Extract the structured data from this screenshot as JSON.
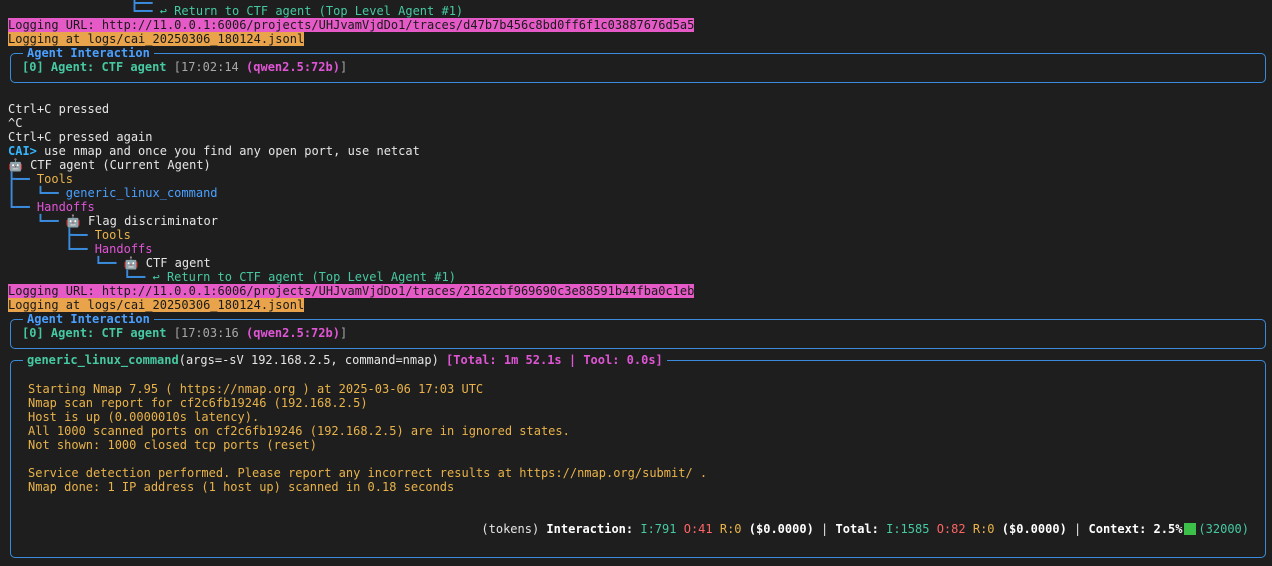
{
  "top": {
    "return_line": "↩ Return to CTF agent (Top Level Agent #1)",
    "log_url_1": "Logging URL: http://11.0.0.1:6006/projects/UHJvamVjdDo1/traces/d47b7b456c8bd0ff6f1c03887676d5a5",
    "log_file_1": "Logging at logs/cai_20250306_180124.jsonl"
  },
  "interaction1": {
    "title": "Agent Interaction",
    "index": "[0]",
    "agent": "Agent: CTF agent",
    "time": "[17:02:14",
    "model": "(qwen2.5:72b)",
    "close": "]"
  },
  "ctrl": {
    "l1": "Ctrl+C pressed",
    "l2": "^C",
    "l3": "Ctrl+C pressed again"
  },
  "prompt": {
    "label": "CAI>",
    "text": " use nmap and once you find any open port, use netcat"
  },
  "tree": {
    "root": "🤖 CTF agent (Current Agent)",
    "tools": "Tools",
    "tool1": "generic_linux_command",
    "handoffs": "Handoffs",
    "flag": "🤖 Flag discriminator",
    "tools2": "Tools",
    "handoffs2": "Handoffs",
    "ctf": "🤖 CTF agent",
    "return": "↩ Return to CTF agent (Top Level Agent #1)"
  },
  "log2": {
    "url": "Logging URL: http://11.0.0.1:6006/projects/UHJvamVjdDo1/traces/2162cbf969690c3e88591b44fba0c1eb",
    "file": "Logging at logs/cai_20250306_180124.jsonl"
  },
  "interaction2": {
    "title": "Agent Interaction",
    "index": "[0]",
    "agent": "Agent: CTF agent",
    "time": "[17:03:16",
    "model": "(qwen2.5:72b)",
    "close": "]"
  },
  "tool_box": {
    "name": "generic_linux_command",
    "args": "(args=-sV 192.168.2.5, command=nmap)",
    "total": "[Total: 1m 52.1s | Tool: 0.0s]",
    "output": [
      "Starting Nmap 7.95 ( https://nmap.org ) at 2025-03-06 17:03 UTC",
      "Nmap scan report for cf2c6fb19246 (192.168.2.5)",
      "Host is up (0.0000010s latency).",
      "All 1000 scanned ports on cf2c6fb19246 (192.168.2.5) are in ignored states.",
      "Not shown: 1000 closed tcp ports (reset)",
      "",
      "Service detection performed. Please report any incorrect results at https://nmap.org/submit/ .",
      "Nmap done: 1 IP address (1 host up) scanned in 0.18 seconds"
    ],
    "tokens": {
      "prefix": "(tokens)",
      "interaction_label": "Interaction:",
      "i1": "I:791",
      "o1": "O:41",
      "r1": "R:0",
      "cost1": "($0.0000)",
      "sep1": "|",
      "total_label": "Total:",
      "i2": "I:1585",
      "o2": "O:82",
      "r2": "R:0",
      "cost2": "($0.0000)",
      "sep2": "|",
      "context_label": "Context: 2.5%",
      "context_max": "(32000)"
    }
  },
  "colors": {
    "background": "#1e1e1e",
    "box_border": "#3a8bdc",
    "pink_highlight": "#e55ac7",
    "orange_highlight": "#e8a34b",
    "green": "#46c9a2",
    "pink": "#e055d6",
    "yellow": "#e9b34a"
  }
}
